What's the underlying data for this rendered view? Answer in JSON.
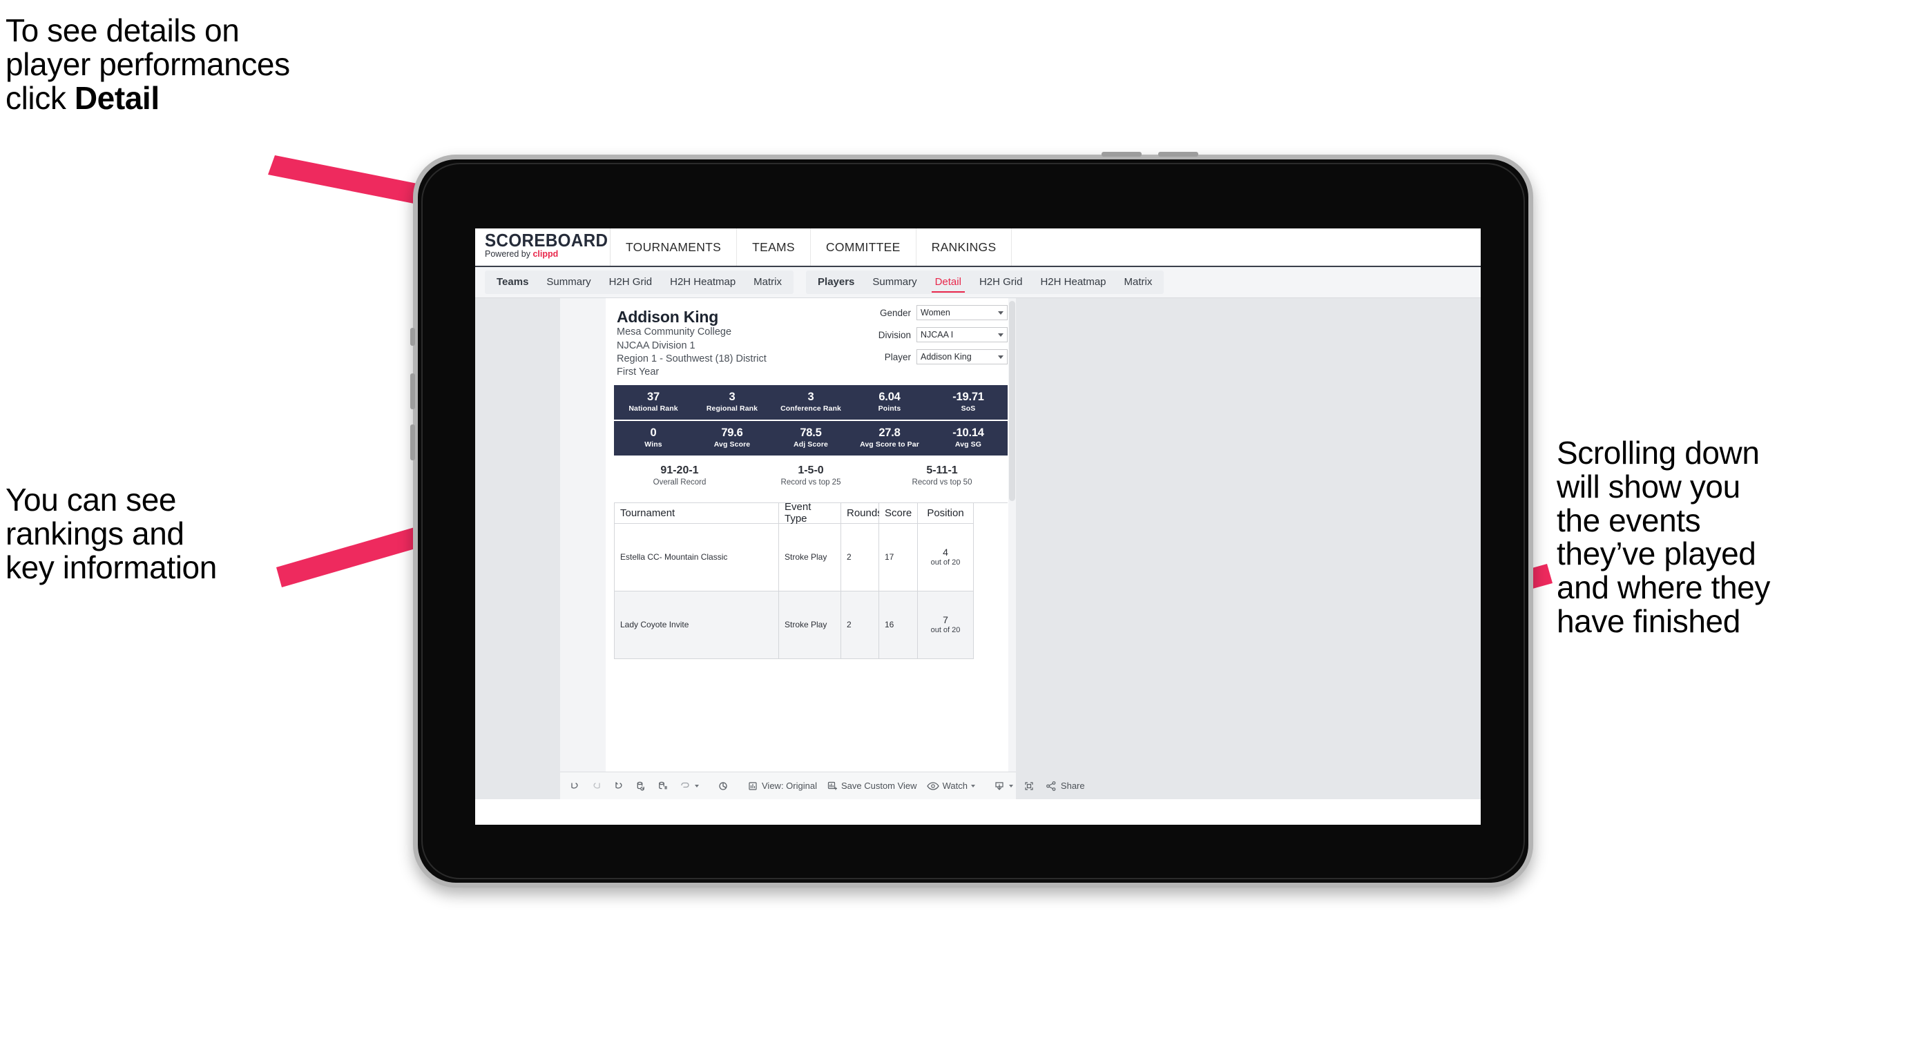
{
  "annotations": {
    "detail": "To see details on\nplayer performances\nclick ",
    "detail_bold": "Detail",
    "rankings": "You can see\nrankings and\nkey information",
    "scrolling": "Scrolling down\nwill show you\nthe events\nthey’ve played\nand where they\nhave finished"
  },
  "colors": {
    "accent_pink": "#e8274b",
    "stat_navy": "#2e3550",
    "arrow": "#ee2a5e"
  },
  "brand": {
    "logo_word": "SCOREBOARD",
    "logo_sub_prefix": "Powered by ",
    "logo_sub_brand": "clippd"
  },
  "topnav": [
    {
      "label": "TOURNAMENTS"
    },
    {
      "label": "TEAMS"
    },
    {
      "label": "COMMITTEE"
    },
    {
      "label": "RANKINGS"
    }
  ],
  "tabs": {
    "group_teams": [
      {
        "label": "Teams",
        "head": true,
        "active": false
      },
      {
        "label": "Summary",
        "head": false,
        "active": false
      },
      {
        "label": "H2H Grid",
        "head": false,
        "active": false
      },
      {
        "label": "H2H Heatmap",
        "head": false,
        "active": false
      },
      {
        "label": "Matrix",
        "head": false,
        "active": false
      }
    ],
    "group_players": [
      {
        "label": "Players",
        "head": true,
        "active": false
      },
      {
        "label": "Summary",
        "head": false,
        "active": false
      },
      {
        "label": "Detail",
        "head": false,
        "active": true
      },
      {
        "label": "H2H Grid",
        "head": false,
        "active": false
      },
      {
        "label": "H2H Heatmap",
        "head": false,
        "active": false
      },
      {
        "label": "Matrix",
        "head": false,
        "active": false
      }
    ]
  },
  "player": {
    "name": "Addison King",
    "college": "Mesa Community College",
    "division": "NJCAA Division 1",
    "region": "Region 1 - Southwest (18) District",
    "year": "First Year"
  },
  "filters": [
    {
      "label": "Gender",
      "value": "Women"
    },
    {
      "label": "Division",
      "value": "NJCAA I"
    },
    {
      "label": "Player",
      "value": "Addison King"
    }
  ],
  "stats_row_1": [
    {
      "value": "37",
      "label": "National Rank"
    },
    {
      "value": "3",
      "label": "Regional Rank"
    },
    {
      "value": "3",
      "label": "Conference Rank"
    },
    {
      "value": "6.04",
      "label": "Points"
    },
    {
      "value": "-19.71",
      "label": "SoS"
    }
  ],
  "stats_row_2": [
    {
      "value": "0",
      "label": "Wins"
    },
    {
      "value": "79.6",
      "label": "Avg Score"
    },
    {
      "value": "78.5",
      "label": "Adj Score"
    },
    {
      "value": "27.8",
      "label": "Avg Score to Par"
    },
    {
      "value": "-10.14",
      "label": "Avg SG"
    }
  ],
  "records": [
    {
      "value": "91-20-1",
      "label": "Overall Record"
    },
    {
      "value": "1-5-0",
      "label": "Record vs top 25"
    },
    {
      "value": "5-11-1",
      "label": "Record vs top 50"
    }
  ],
  "table": {
    "headers": [
      "Tournament",
      "Event Type",
      "Rounds",
      "Score",
      "Position"
    ],
    "rows": [
      {
        "tournament": "Estella CC- Mountain Classic",
        "event_type": "Stroke Play",
        "rounds": "2",
        "score": "17",
        "position": "4",
        "position_sub": "out of 20"
      },
      {
        "tournament": "Lady Coyote Invite",
        "event_type": "Stroke Play",
        "rounds": "2",
        "score": "16",
        "position": "7",
        "position_sub": "out of 20"
      }
    ]
  },
  "toolbar": {
    "view_label": "View: Original",
    "save_label": "Save Custom View",
    "watch_label": "Watch",
    "share_label": "Share"
  }
}
